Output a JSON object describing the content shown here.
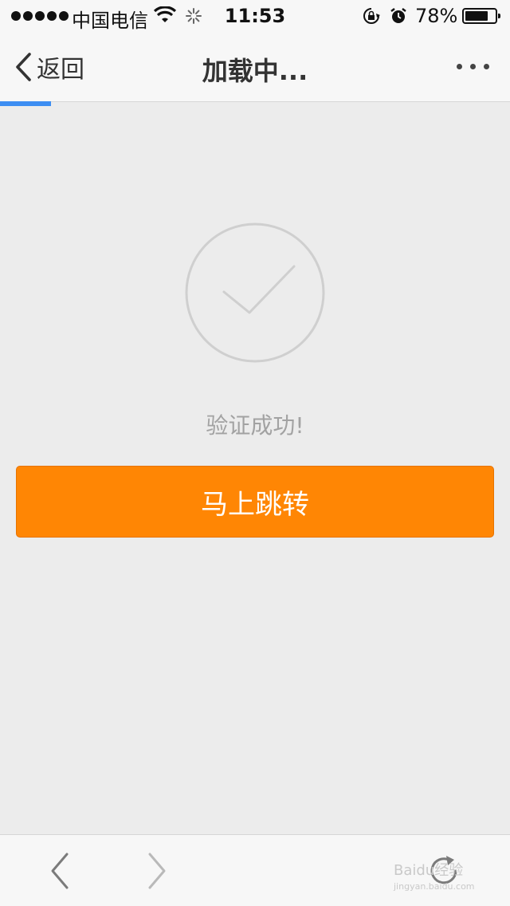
{
  "status_bar": {
    "carrier": "中国电信",
    "time": "11:53",
    "battery_percent": "78%",
    "battery_level": 0.78,
    "icons": [
      "signal-dots-icon",
      "wifi-icon",
      "activity-spinner-icon",
      "rotation-lock-icon",
      "alarm-icon",
      "battery-icon"
    ]
  },
  "nav": {
    "back_label": "返回",
    "title": "加载中...",
    "more_icon": "more-dots-icon",
    "load_progress": 0.1
  },
  "content": {
    "success_icon": "check-circle-icon",
    "message": "验证成功!",
    "button_label": "马上跳转"
  },
  "toolbar": {
    "icons": [
      "chevron-left-icon",
      "chevron-right-icon",
      "refresh-icon"
    ]
  },
  "watermark": {
    "line1": "Baidu经验",
    "line2": "jingyan.baidu.com"
  },
  "colors": {
    "accent_orange": "#ff8604",
    "progress_blue": "#3d8ef2",
    "background": "#ececec",
    "message_gray": "#a2a2a2"
  }
}
